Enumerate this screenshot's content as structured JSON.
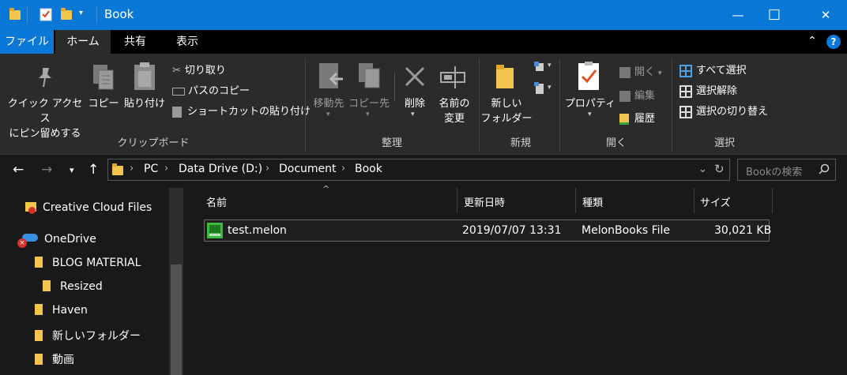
{
  "window": {
    "title": "Book",
    "minimize_glyph": "—",
    "maximize_glyph": "☐",
    "close_glyph": "✕"
  },
  "tabs": [
    {
      "label": "ファイル",
      "active": false
    },
    {
      "label": "ホーム",
      "active": true
    },
    {
      "label": "共有",
      "active": false
    },
    {
      "label": "表示",
      "active": false
    }
  ],
  "ribbon": {
    "clipboard": {
      "group_label": "クリップボード",
      "pin_label_1": "クイック アクセス",
      "pin_label_2": "にピン留めする",
      "copy_label": "コピー",
      "paste_label": "貼り付け",
      "cut_label": "切り取り",
      "copy_path_label": "パスのコピー",
      "paste_shortcut_label": "ショートカットの貼り付け"
    },
    "organize": {
      "group_label": "整理",
      "move_to_label": "移動先",
      "copy_to_label": "コピー先",
      "delete_label": "削除",
      "rename_label_1": "名前の",
      "rename_label_2": "変更"
    },
    "new": {
      "group_label": "新規",
      "new_folder_label_1": "新しい",
      "new_folder_label_2": "フォルダー"
    },
    "open": {
      "group_label": "開く",
      "properties_label": "プロパティ",
      "open_label": "開く",
      "edit_label": "編集",
      "history_label": "履歴"
    },
    "select": {
      "group_label": "選択",
      "select_all_label": "すべて選択",
      "select_none_label": "選択解除",
      "invert_label": "選択の切り替え"
    }
  },
  "address": {
    "breadcrumbs": [
      "PC",
      "Data Drive (D:)",
      "Document",
      "Book"
    ],
    "search_placeholder": "Bookの検索"
  },
  "nav_pane": {
    "items": [
      {
        "label": "Creative Cloud Files"
      },
      {
        "label": "OneDrive"
      },
      {
        "label": "BLOG MATERIAL"
      },
      {
        "label": "Resized"
      },
      {
        "label": "Haven"
      },
      {
        "label": "新しいフォルダー"
      },
      {
        "label": "動画"
      }
    ]
  },
  "file_list": {
    "columns": [
      "名前",
      "更新日時",
      "種類",
      "サイズ"
    ],
    "rows": [
      {
        "name": "test.melon",
        "modified": "2019/07/07 13:31",
        "type": "MelonBooks File",
        "size": "30,021 KB"
      }
    ]
  },
  "colors": {
    "accent": "#0a78d7",
    "ribbon_bg": "#2b2b2b",
    "window_bg": "#191919",
    "folder_yellow": "#f4c54d"
  }
}
